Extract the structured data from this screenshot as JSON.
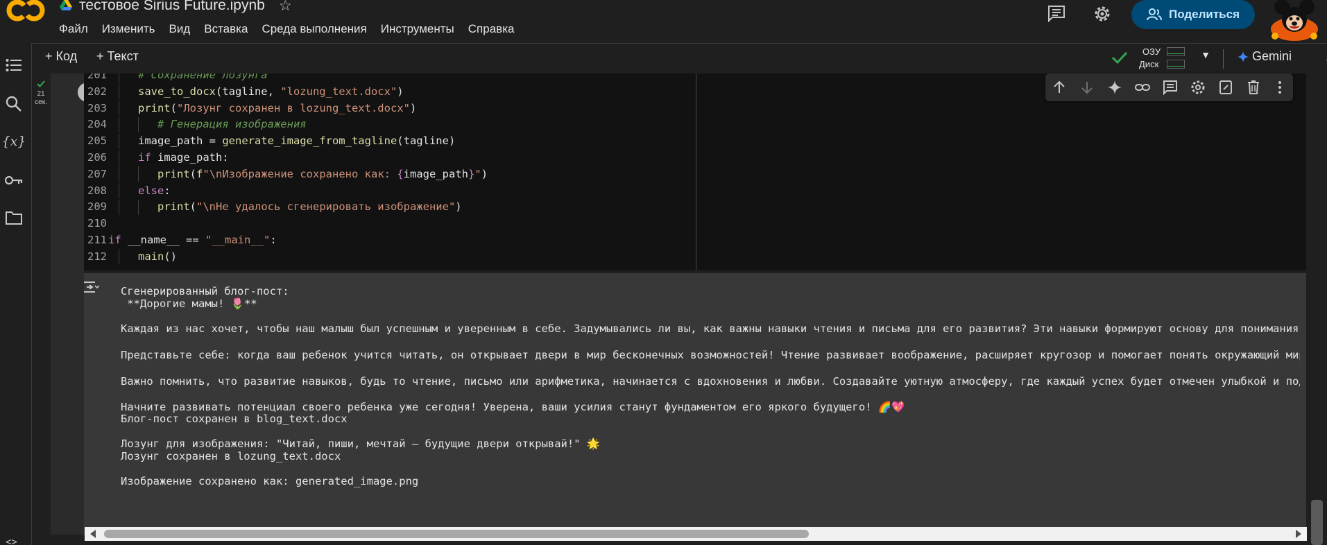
{
  "header": {
    "logo_text": "CO",
    "title": "тестовое Sirius Future.ipynb",
    "share_label": "Поделиться",
    "menu": [
      "Файл",
      "Изменить",
      "Вид",
      "Вставка",
      "Среда выполнения",
      "Инструменты",
      "Справка"
    ]
  },
  "toolbar": {
    "add_code": "+ Код",
    "add_text": "+ Текст",
    "ram_label": "ОЗУ",
    "disk_label": "Диск",
    "gemini_label": "Gemini"
  },
  "cell": {
    "exec_time": "21",
    "exec_unit": "сек.",
    "code_lines": [
      {
        "n": "201",
        "indent": 1,
        "text": "# Сохранение лозунга"
      },
      {
        "n": "202",
        "indent": 1,
        "text": "save_to_docx(tagline, \"lozung_text.docx\")"
      },
      {
        "n": "203",
        "indent": 1,
        "text": "print(\"Лозунг сохранен в lozung_text.docx\")"
      },
      {
        "n": "204",
        "indent": 2,
        "text": "# Генерация изображения"
      },
      {
        "n": "205",
        "indent": 1,
        "text": "image_path = generate_image_from_tagline(tagline)"
      },
      {
        "n": "206",
        "indent": 1,
        "text": "if image_path:"
      },
      {
        "n": "207",
        "indent": 2,
        "text": "print(f\"\\nИзображение сохранено как: {image_path}\")"
      },
      {
        "n": "208",
        "indent": 1,
        "text": "else:"
      },
      {
        "n": "209",
        "indent": 2,
        "text": "print(\"\\nНе удалось сгенерировать изображение\")"
      },
      {
        "n": "210",
        "indent": 0,
        "text": ""
      },
      {
        "n": "211",
        "indent": 0,
        "text": "if __name__ == \"__main__\":"
      },
      {
        "n": "212",
        "indent": 1,
        "text": "main()"
      }
    ],
    "output_lines": [
      "Сгенерированный блог-пост:",
      " **Дорогие мамы! 🌷**",
      "",
      "Каждая из нас хочет, чтобы наш малыш был успешным и уверенным в себе. Задумывались ли вы, как важны навыки чтения и письма для его развития? Эти навыки формируют основу для понимания",
      "",
      "Представьте себе: когда ваш ребенок учится читать, он открывает двери в мир бесконечных возможностей! Чтение развивает воображение, расширяет кругозор и помогает понять окружающий мир",
      "",
      "Важно помнить, что развитие навыков, будь то чтение, письмо или арифметика, начинается с вдохновения и любви. Создавайте уютную атмосферу, где каждый успех будет отмечен улыбкой и под",
      "",
      "Начните развивать потенциал своего ребенка уже сегодня! Уверена, ваши усилия станут фундаментом его яркого будущего! 🌈💖",
      "Блог-пост сохранен в blog_text.docx",
      "",
      "Лозунг для изображения: \"Читай, пиши, мечтай — будущие двери открывай!\" 🌟",
      "Лозунг сохранен в lozung_text.docx",
      "",
      "Изображение сохранено как: generated_image.png"
    ]
  },
  "colors": {
    "accent_orange": "#f9ab00",
    "share_bg": "#004a77",
    "share_text": "#c2e7ff",
    "check_green": "#34a853",
    "gemini_blue": "#4285f4"
  }
}
